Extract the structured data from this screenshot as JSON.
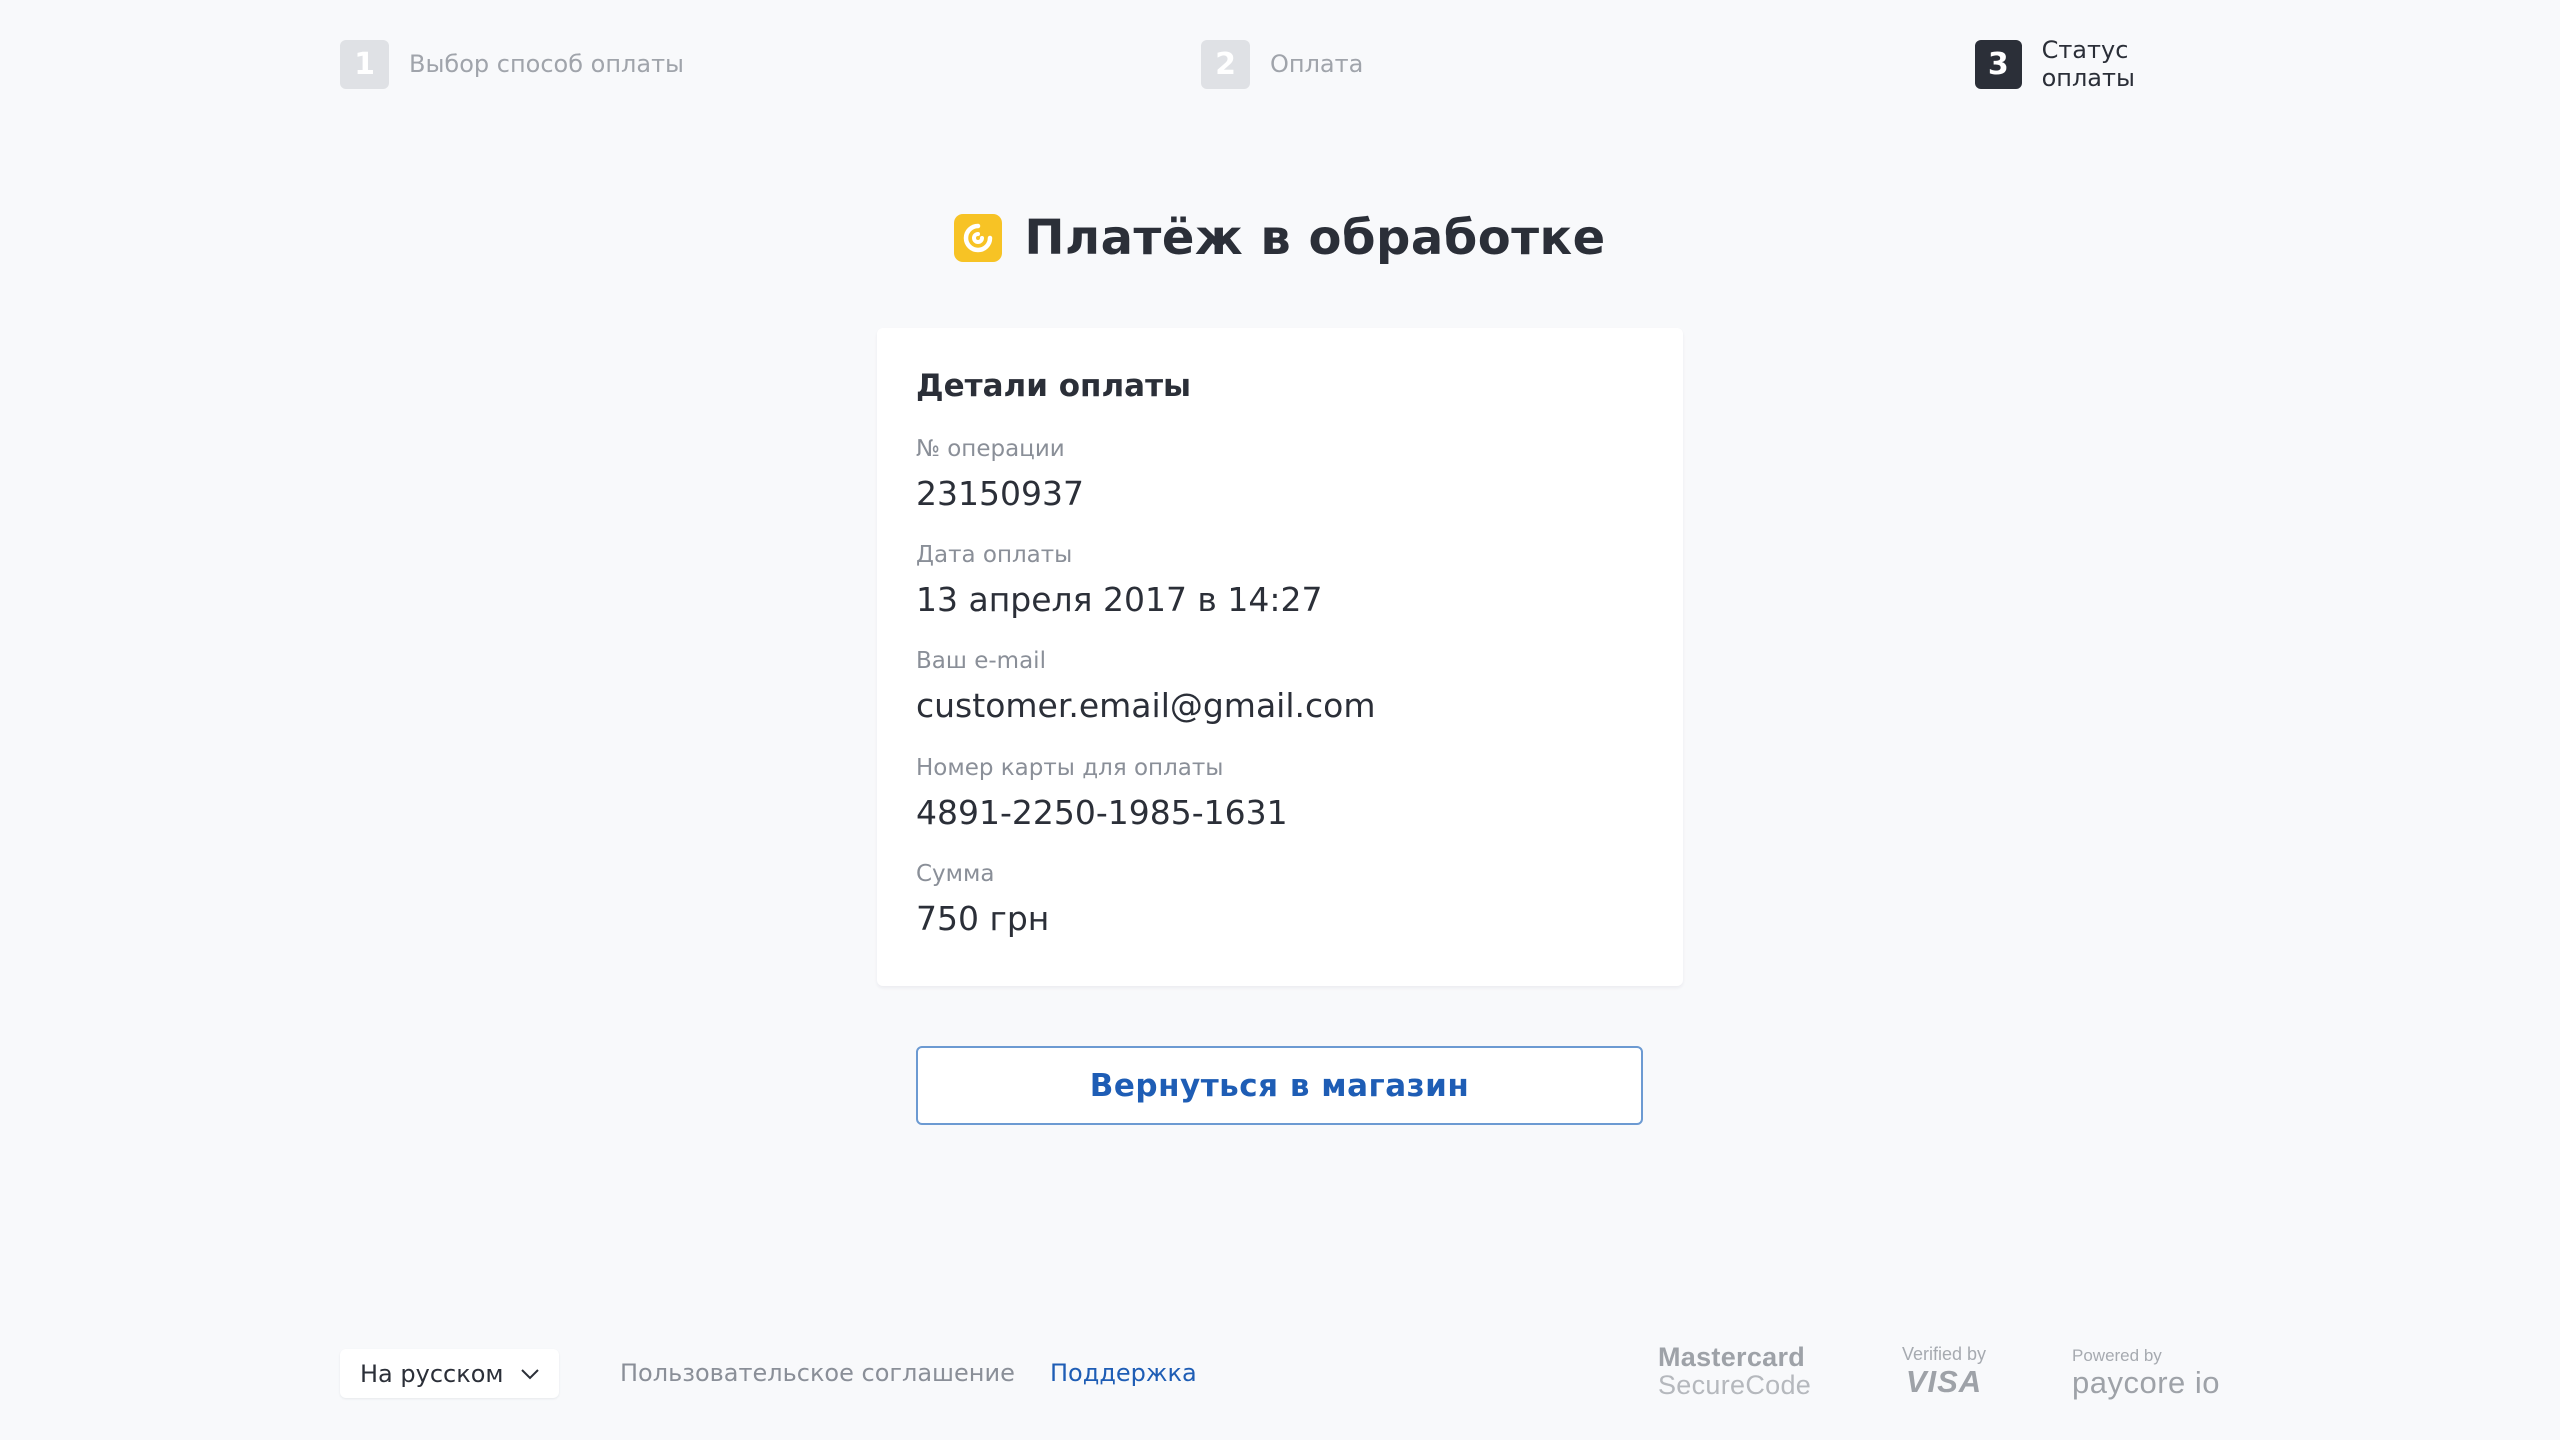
{
  "steps": [
    {
      "num": "1",
      "label": "Выбор способ оплаты",
      "state": "inactive"
    },
    {
      "num": "2",
      "label": "Оплата",
      "state": "inactive"
    },
    {
      "num": "3",
      "label": "Статус оплаты",
      "state": "active"
    }
  ],
  "status": {
    "title": "Платёж в обработке",
    "icon": "processing-icon",
    "icon_color": "#f7c325"
  },
  "details": {
    "title": "Детали оплаты",
    "fields": [
      {
        "label": "№ операции",
        "value": "23150937"
      },
      {
        "label": "Дата оплаты",
        "value": "13 апреля 2017 в 14:27"
      },
      {
        "label": "Ваш e-mail",
        "value": "customer.email@gmail.com"
      },
      {
        "label": "Номер карты для оплаты",
        "value": "4891-2250-1985-1631"
      },
      {
        "label": "Сумма",
        "value": "750 грн"
      }
    ]
  },
  "actions": {
    "back_label": "Вернуться в магазин"
  },
  "footer": {
    "language": "На русском",
    "terms": "Пользовательское соглашение",
    "support": "Поддержка",
    "logos": {
      "mastercard_line1": "Mastercard",
      "mastercard_line2": "SecureCode",
      "visa_line1": "Verified by",
      "visa_line2": "VISA",
      "paycore_line1": "Powered by",
      "paycore_line2": "paycore io"
    }
  },
  "colors": {
    "accent": "#1e5db5",
    "active_step": "#2b2f38",
    "inactive_step": "#dfe1e5",
    "background": "#f8f9fb"
  }
}
